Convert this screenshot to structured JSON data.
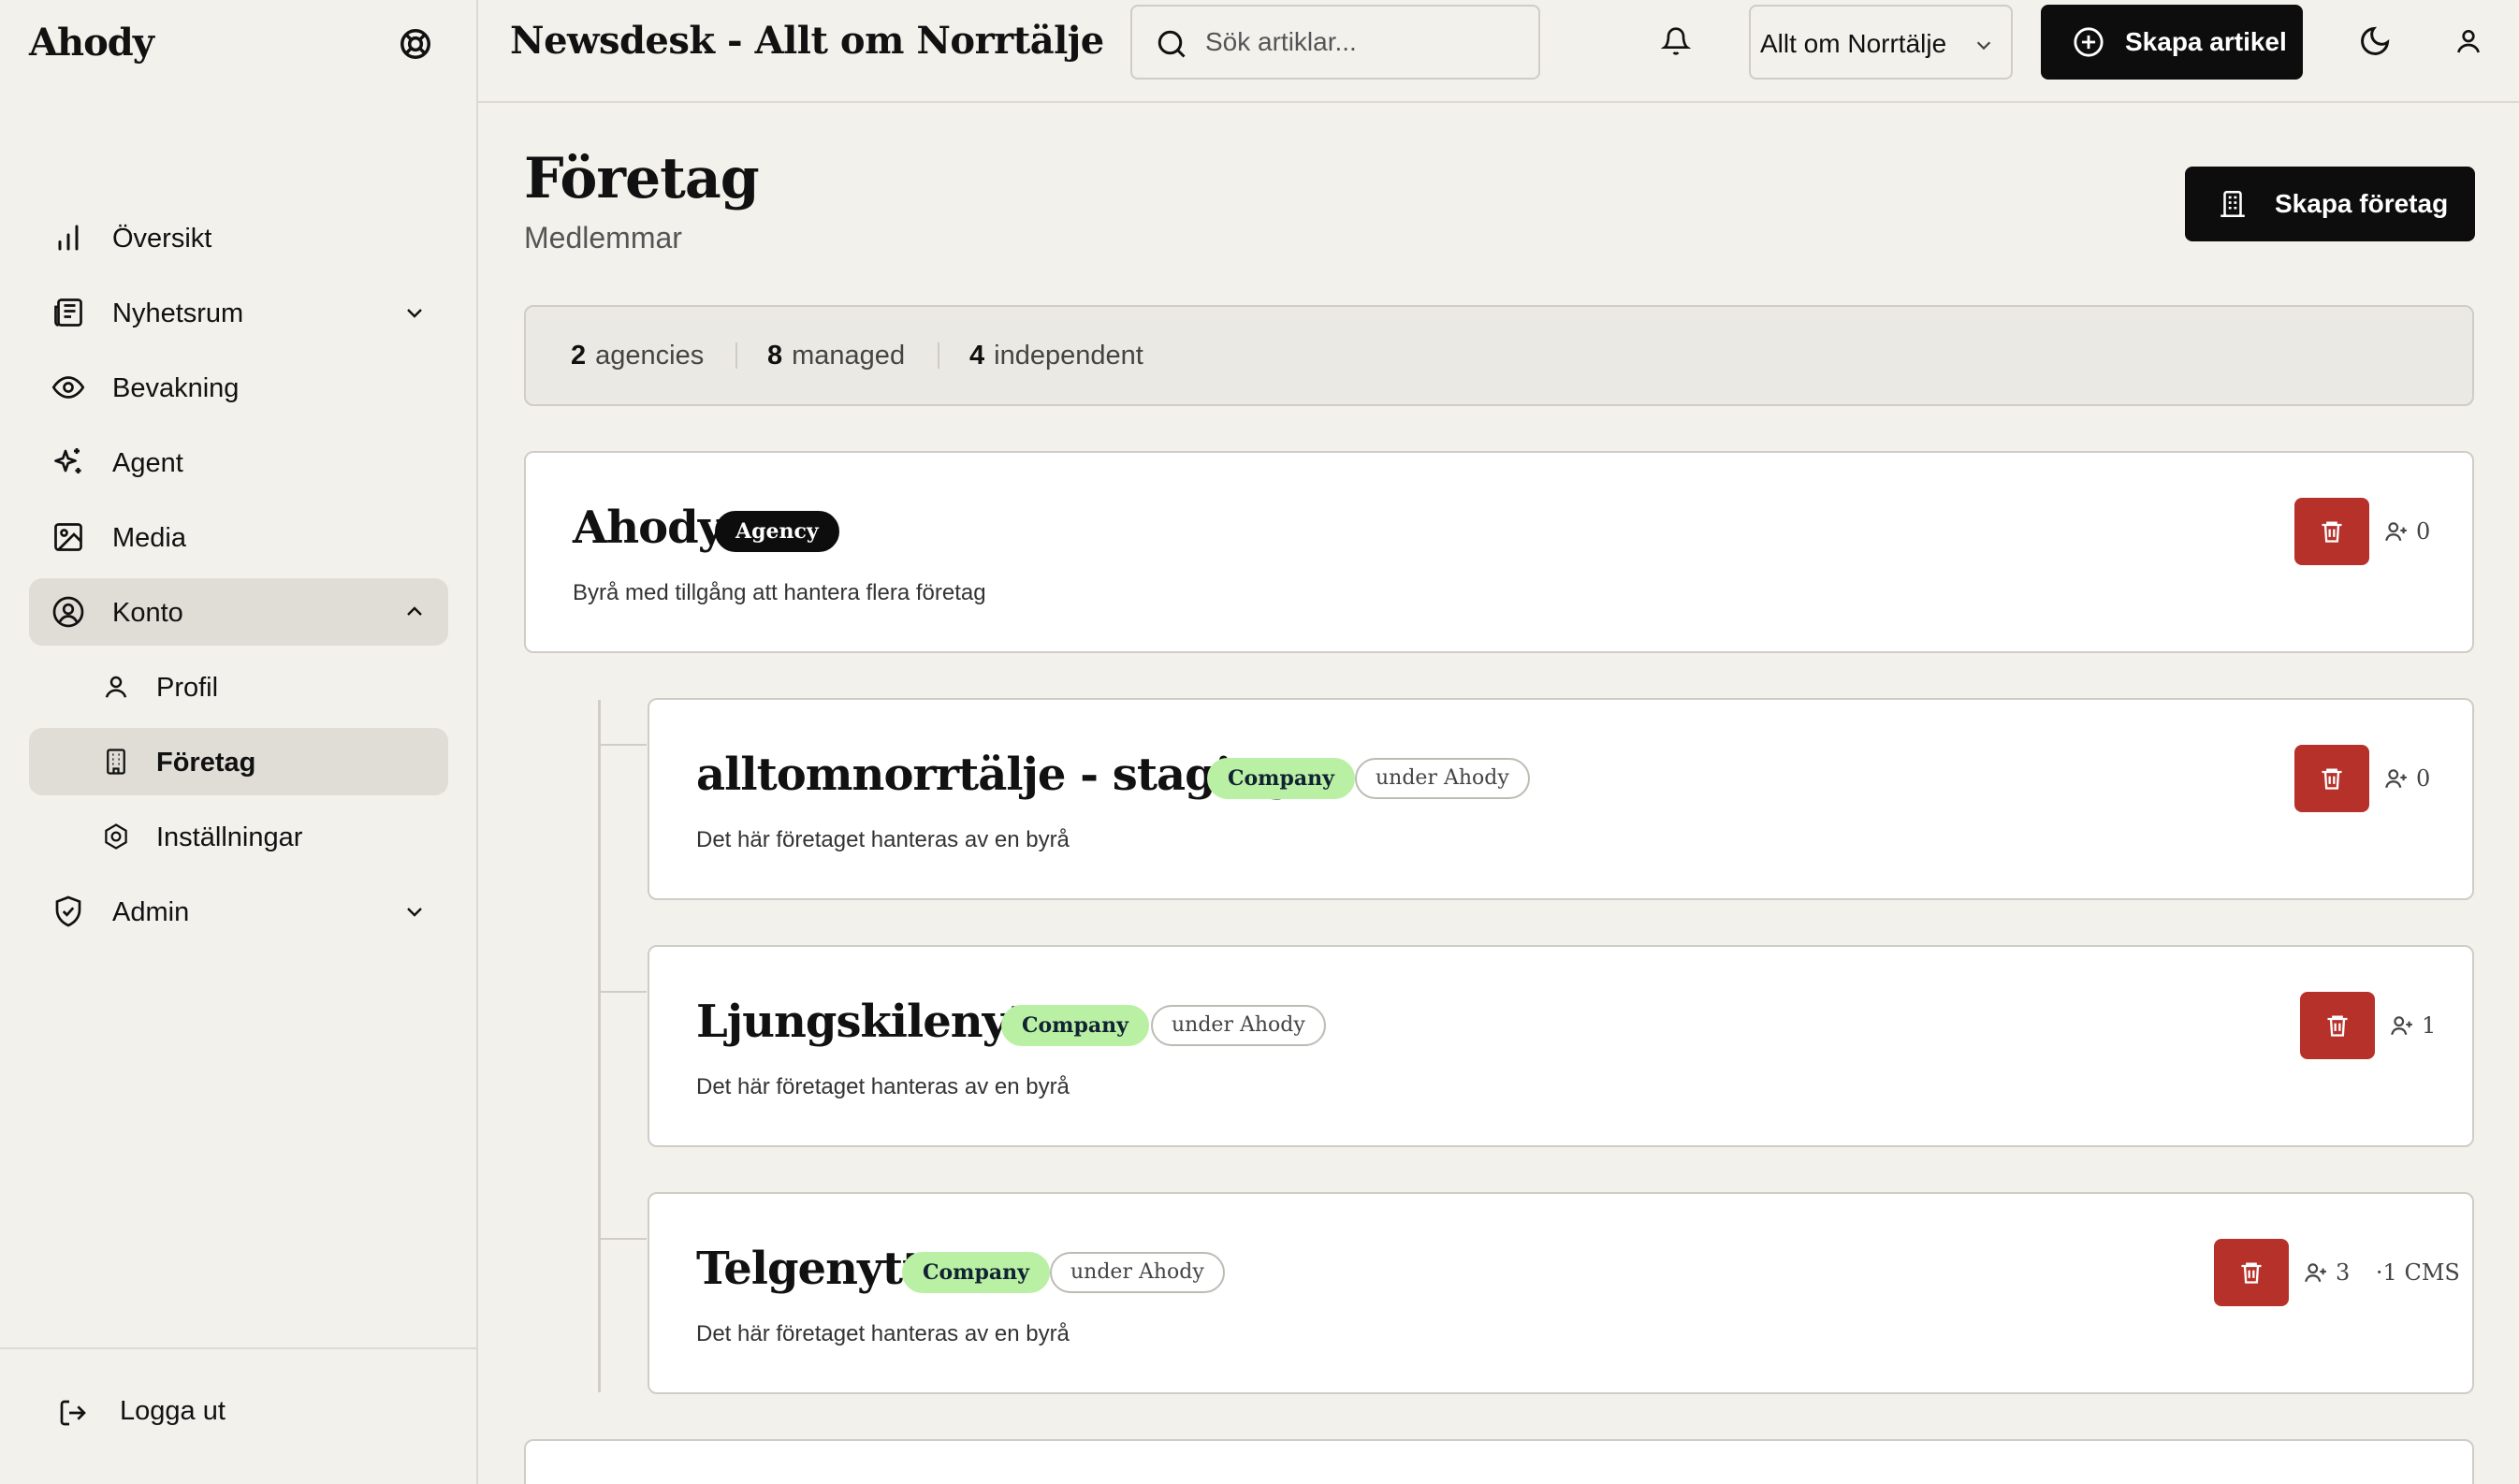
{
  "sidebar": {
    "brand": "Ahody",
    "items": [
      {
        "label": "Översikt"
      },
      {
        "label": "Nyhetsrum"
      },
      {
        "label": "Bevakning"
      },
      {
        "label": "Agent"
      },
      {
        "label": "Media"
      },
      {
        "label": "Konto"
      },
      {
        "label": "Profil"
      },
      {
        "label": "Företag"
      },
      {
        "label": "Inställningar"
      },
      {
        "label": "Admin"
      }
    ],
    "logout": "Logga ut"
  },
  "topbar": {
    "title": "Newsdesk - Allt om Norrtälje",
    "search_placeholder": "Sök artiklar...",
    "workspace": "Allt om Norrtälje",
    "create_article": "Skapa artikel"
  },
  "page": {
    "title": "Företag",
    "subtitle": "Medlemmar",
    "create_company": "Skapa företag"
  },
  "stats": [
    {
      "value": "2",
      "label": "agencies"
    },
    {
      "value": "8",
      "label": "managed"
    },
    {
      "value": "4",
      "label": "independent"
    }
  ],
  "companies": [
    {
      "name": "Ahody",
      "type": "Agency",
      "description": "Byrå med tillgång att hantera flera företag",
      "members": "0"
    },
    {
      "name": "alltomnorrtälje - staging",
      "type": "Company",
      "parent": "under Ahody",
      "description": "Det här företaget hanteras av en byrå",
      "members": "0"
    },
    {
      "name": "Ljungskilenytt",
      "type": "Company",
      "parent": "under Ahody",
      "description": "Det här företaget hanteras av en byrå",
      "members": "1"
    },
    {
      "name": "Telgenytt",
      "type": "Company",
      "parent": "under Ahody",
      "description": "Det här företaget hanteras av en byrå",
      "members": "3",
      "cms": "·1 CMS"
    }
  ],
  "colors": {
    "accent": "#0d0d0d",
    "danger": "#b7312b",
    "company_badge": "#b9f0a3",
    "background": "#f2f1ec"
  }
}
